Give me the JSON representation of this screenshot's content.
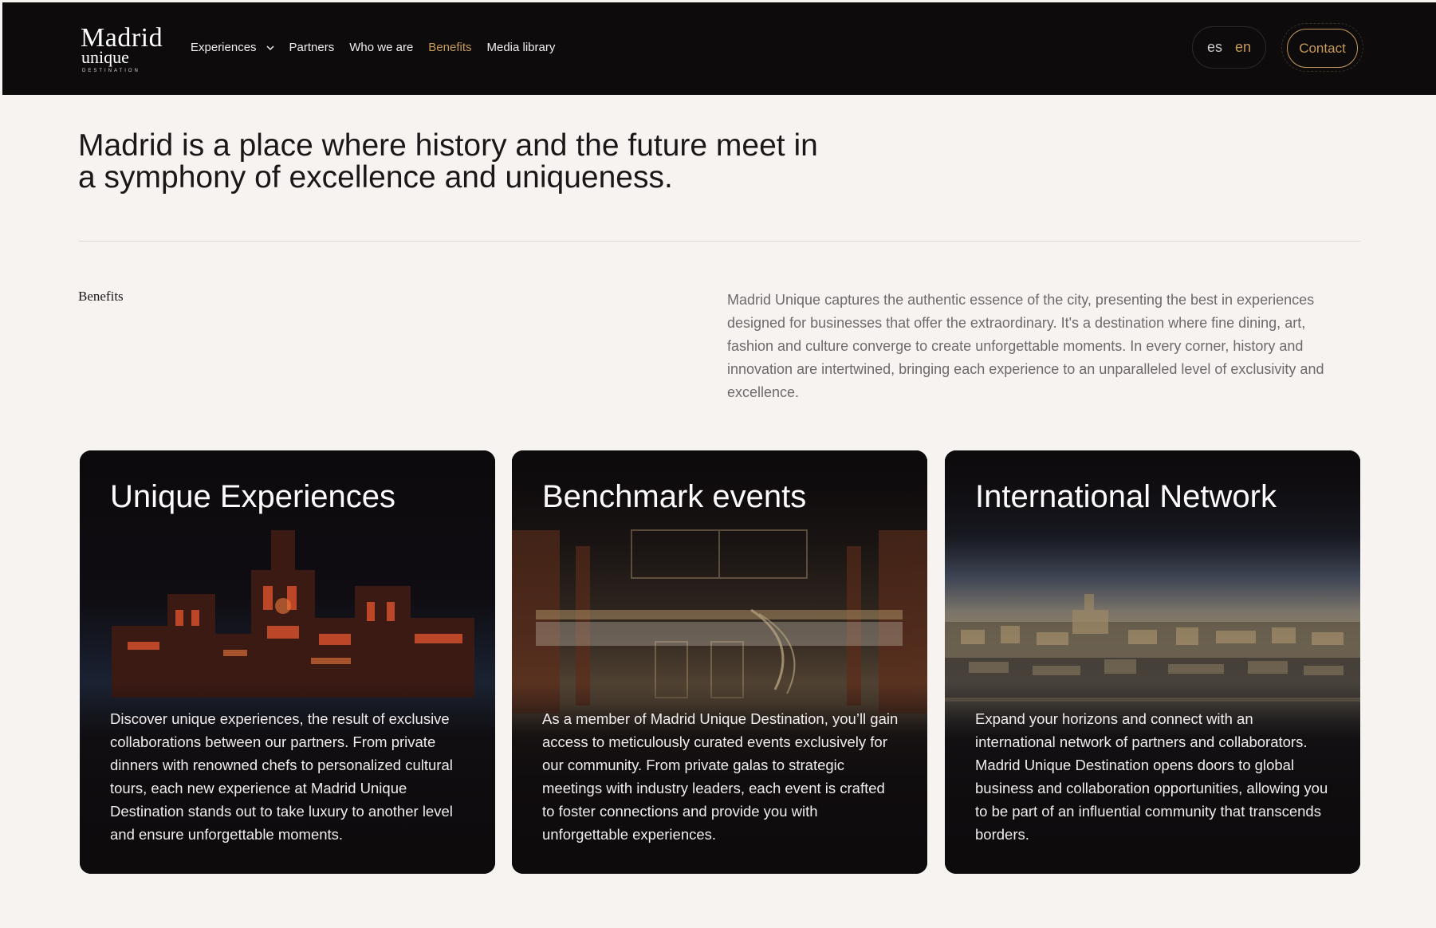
{
  "brand": {
    "name": "Madrid",
    "sub": "unique",
    "tag": "DESTINATION"
  },
  "nav": {
    "items": [
      {
        "label": "Experiences",
        "has_dropdown": true,
        "active": false
      },
      {
        "label": "Partners",
        "active": false
      },
      {
        "label": "Who we are",
        "active": false
      },
      {
        "label": "Benefits",
        "active": true
      },
      {
        "label": "Media library",
        "active": false
      }
    ]
  },
  "lang": {
    "es": "es",
    "en": "en",
    "selected": "en"
  },
  "contact_label": "Contact",
  "hero": {
    "headline": "Madrid is a place where history and the future meet in a symphony of excellence and uniqueness."
  },
  "section": {
    "label": "Benefits",
    "intro": "Madrid Unique captures the authentic essence of the city, presenting the best in experiences designed for businesses that offer the extraordinary. It's a destination where fine dining, art, fashion and culture converge to create unforgettable moments. In every corner, history and innovation are intertwined, bringing each experience to an unparalleled level of exclusivity and excellence."
  },
  "cards": [
    {
      "title": "Unique Experiences",
      "text": "Discover unique experiences, the result of exclusive collaborations between our partners. From private dinners with renowned chefs to personalized cultural tours, each new experience at Madrid Unique Destination stands out to take luxury to another level and ensure unforgettable moments.",
      "image": "illuminated-palace-night"
    },
    {
      "title": "Benchmark events",
      "text": "As a member of Madrid Unique Destination, you’ll gain access to meticulously curated events exclusively for our community. From private galas to strategic meetings with industry leaders, each event is crafted to foster connections and provide you with unforgettable experiences.",
      "image": "interior-atrium-staircase"
    },
    {
      "title": "International Network",
      "text": "Expand your horizons and connect with an international network of partners and collaborators. Madrid Unique Destination opens doors to global business and collaboration opportunities, allowing you to be part of an influential community that transcends borders.",
      "image": "madrid-city-skyline"
    }
  ],
  "colors": {
    "nav_bg": "#0d0b0c",
    "accent": "#c79a5a",
    "page_bg": "#f6f3f1",
    "card_bg": "#0e0b0d"
  }
}
